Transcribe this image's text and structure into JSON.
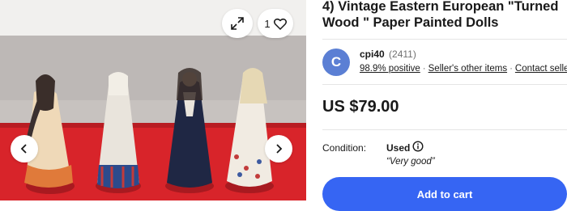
{
  "gallery": {
    "watch_count": "1",
    "icons": {
      "expand": "expand-icon",
      "watch": "heart-icon",
      "prev": "chevron-left-icon",
      "next": "chevron-right-icon"
    },
    "colors": {
      "backdrop": "#f1f0ee",
      "table": "#d8242a",
      "wall": "#c7c2bf"
    }
  },
  "listing": {
    "title": "4) Vintage Eastern European \"Turned Wood \" Paper Painted Dolls",
    "price": "US $79.00",
    "condition_label": "Condition:",
    "condition_value": "Used",
    "condition_note": "“Very good”"
  },
  "seller": {
    "initial": "C",
    "name": "cpi40",
    "score": "(2411)",
    "feedback": "98.9% positive",
    "other_items": "Seller's other items",
    "contact": "Contact seller",
    "avatar_color": "#5b7fd4"
  },
  "actions": {
    "add_to_cart": "Add to cart",
    "accent_color": "#3665f3"
  }
}
